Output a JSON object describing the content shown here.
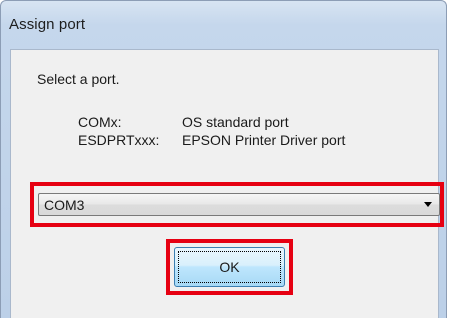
{
  "window": {
    "title": "Assign port"
  },
  "dialog": {
    "prompt": "Select a port.",
    "definitions": [
      {
        "key": "COMx:",
        "value": "OS standard port"
      },
      {
        "key": "ESDPRTxxx:",
        "value": "EPSON Printer Driver port"
      }
    ]
  },
  "port_select": {
    "selected": "COM3",
    "arrow_icon": "chevron-down-icon"
  },
  "ok_button": {
    "label": "OK"
  },
  "colors": {
    "highlight": "#e60012",
    "title_bar": "#c5d7ec",
    "dialog_face": "#f0f0f0",
    "button_border": "#3c7fb1"
  }
}
